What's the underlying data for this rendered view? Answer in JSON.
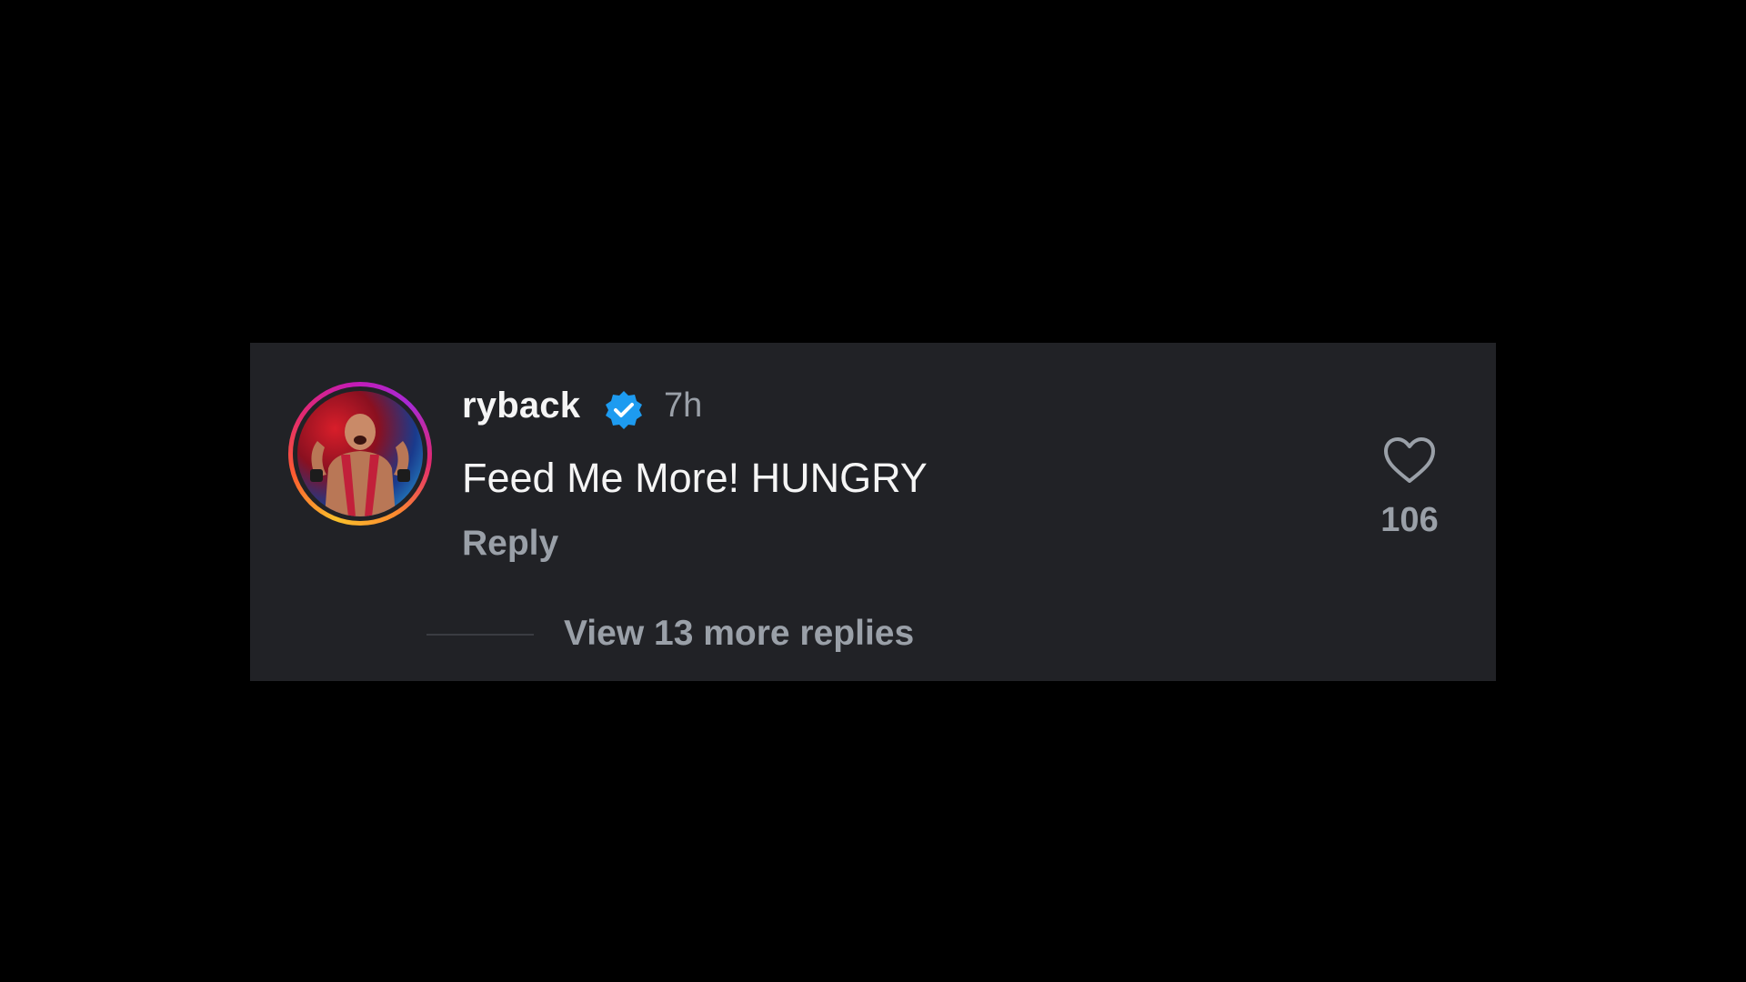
{
  "comment": {
    "username": "ryback",
    "verified_icon": "verified-badge-icon",
    "time_ago": "7h",
    "text": "Feed Me More! HUNGRY",
    "reply_label": "Reply",
    "like_icon": "heart-outline-icon",
    "like_count": "106",
    "view_replies_label": "View 13 more replies"
  },
  "colors": {
    "background": "#000000",
    "card": "#212226",
    "primary_text": "#f5f5f5",
    "secondary_text": "#9aa0a8",
    "verified_blue": "#1d9bf0"
  }
}
